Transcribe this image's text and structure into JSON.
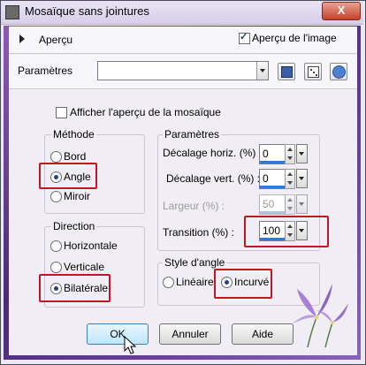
{
  "window": {
    "title": "Mosaïque sans jointures",
    "close_label": "X"
  },
  "toolbar": {
    "apercu_label": "Aperçu",
    "apercu_image_label": "Aperçu de l'image",
    "apercu_image_checked": true
  },
  "params_row": {
    "label": "Paramètres",
    "preset_value": ""
  },
  "mosaic_preview": {
    "label": "Afficher l'aperçu de la mosaïque",
    "checked": false
  },
  "methode": {
    "title": "Méthode",
    "options": [
      "Bord",
      "Angle",
      "Miroir"
    ],
    "selected": "Angle"
  },
  "direction": {
    "title": "Direction",
    "options": [
      "Horizontale",
      "Verticale",
      "Bilatérale"
    ],
    "selected": "Bilatérale"
  },
  "parametres": {
    "title": "Paramètres",
    "decalage_horiz": {
      "label": "Décalage horiz. (%) :",
      "value": "0"
    },
    "decalage_vert": {
      "label": "Décalage vert. (%) :",
      "value": "0"
    },
    "largeur": {
      "label": "Largeur (%) :",
      "value": "50",
      "disabled": true
    },
    "transition": {
      "label": "Transition (%) :",
      "value": "100"
    }
  },
  "style_angle": {
    "title": "Style d'angle",
    "options": [
      "Linéaire",
      "Incurvé"
    ],
    "selected": "Incurvé"
  },
  "buttons": {
    "ok": "OK",
    "annuler": "Annuler",
    "aide": "Aide"
  },
  "colors": {
    "highlight_red": "#c0181e",
    "frame_purple": "#5a3390",
    "spin_blue": "#2a7be0"
  }
}
